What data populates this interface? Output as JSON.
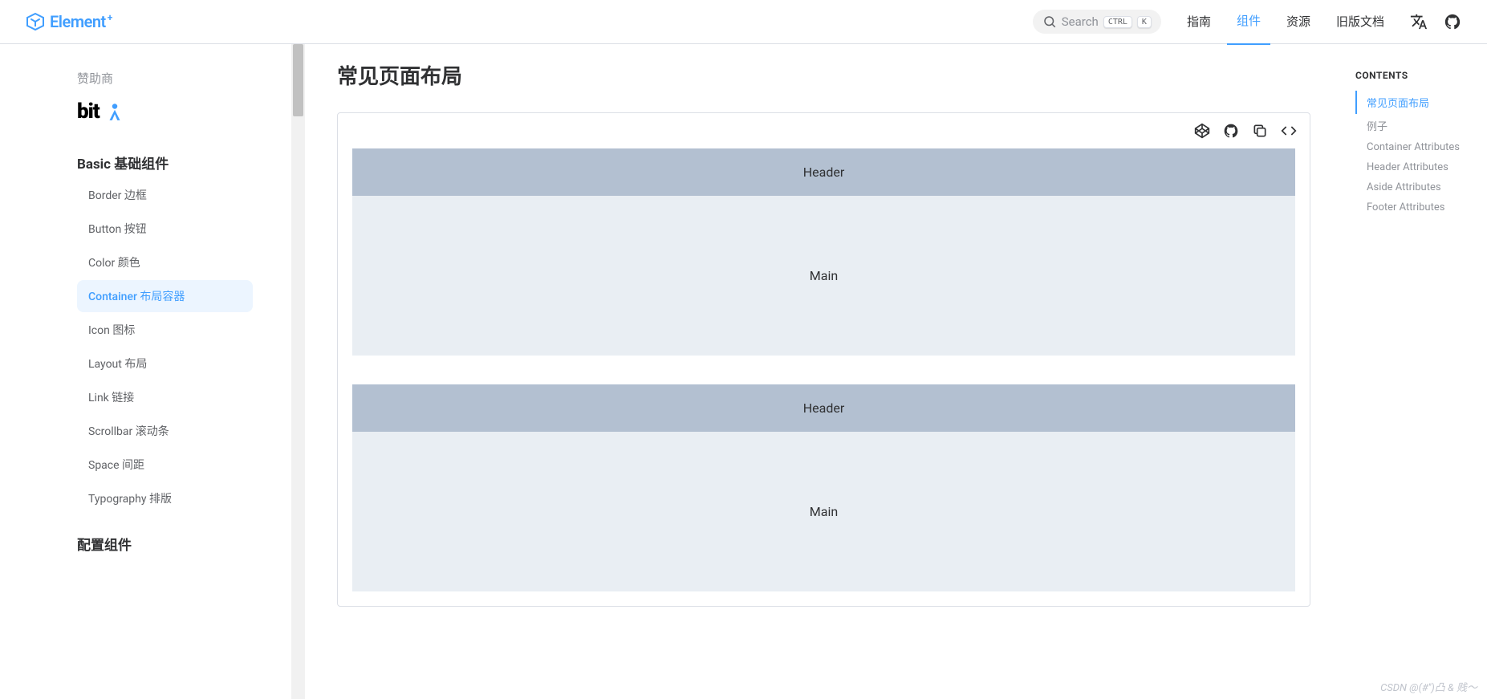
{
  "header": {
    "logo_text": "Element",
    "search_placeholder": "Search",
    "kbd_ctrl": "CTRL",
    "kbd_k": "K",
    "nav": [
      {
        "label": "指南",
        "active": false
      },
      {
        "label": "组件",
        "active": true
      },
      {
        "label": "资源",
        "active": false
      },
      {
        "label": "旧版文档",
        "active": false
      }
    ]
  },
  "sidebar": {
    "sponsor_title": "赞助商",
    "sponsor_name": "bit",
    "groups": [
      {
        "title": "Basic 基础组件",
        "items": [
          {
            "label": "Border 边框",
            "active": false
          },
          {
            "label": "Button 按钮",
            "active": false
          },
          {
            "label": "Color 颜色",
            "active": false
          },
          {
            "label": "Container 布局容器",
            "active": true
          },
          {
            "label": "Icon 图标",
            "active": false
          },
          {
            "label": "Layout 布局",
            "active": false
          },
          {
            "label": "Link 链接",
            "active": false
          },
          {
            "label": "Scrollbar 滚动条",
            "active": false
          },
          {
            "label": "Space 间距",
            "active": false
          },
          {
            "label": "Typography 排版",
            "active": false
          }
        ]
      },
      {
        "title": "配置组件",
        "items": []
      }
    ]
  },
  "main": {
    "title": "常见页面布局",
    "examples": [
      {
        "header": "Header",
        "main": "Main"
      },
      {
        "header": "Header",
        "main": "Main"
      }
    ]
  },
  "toc": {
    "title": "CONTENTS",
    "items": [
      {
        "label": "常见页面布局",
        "active": true
      },
      {
        "label": "例子",
        "active": false
      },
      {
        "label": "Container Attributes",
        "active": false
      },
      {
        "label": "Header Attributes",
        "active": false
      },
      {
        "label": "Aside Attributes",
        "active": false
      },
      {
        "label": "Footer Attributes",
        "active": false
      }
    ]
  },
  "watermark": "CSDN @(#'')凸 & 贱～"
}
